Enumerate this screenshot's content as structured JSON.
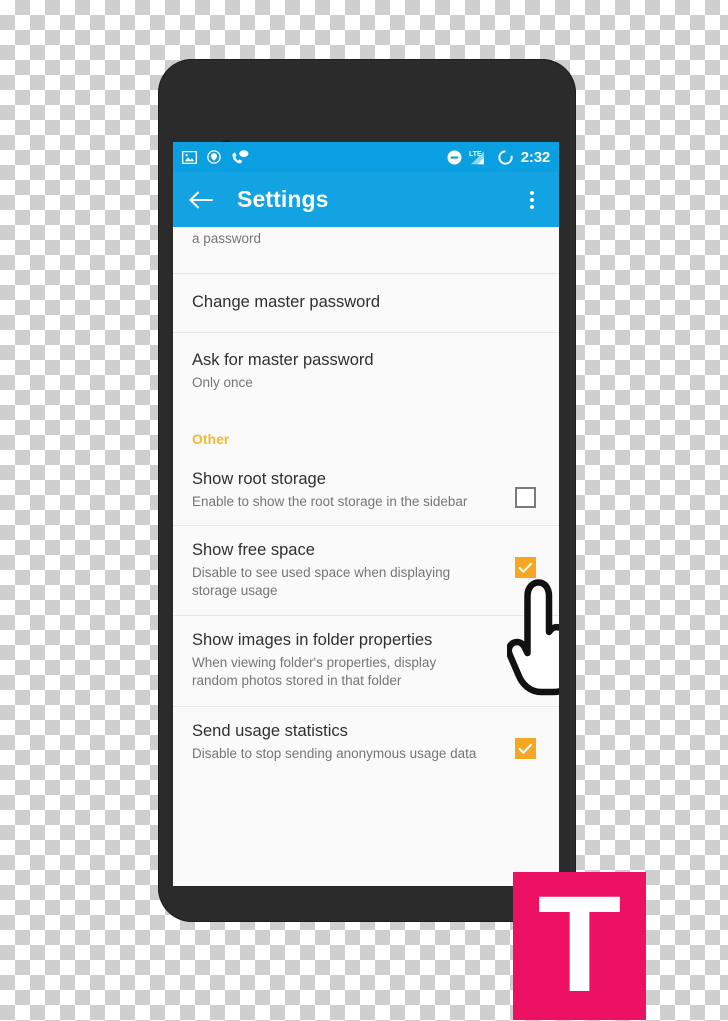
{
  "statusbar": {
    "left_icons": [
      "image-icon",
      "shield-location-icon",
      "phone-missed-call-icon"
    ],
    "right_icons": [
      "do-not-disturb-icon",
      "lte-signal-icon",
      "battery-circle-icon"
    ],
    "lte_label": "LTE",
    "clock": "2:32"
  },
  "appbar": {
    "back_icon": "arrow-back-icon",
    "title": "Settings",
    "overflow_icon": "overflow-menu-icon"
  },
  "list": {
    "partial_row": {
      "subtitle": "a password"
    },
    "rows": [
      {
        "name": "change-master-password",
        "title": "Change master password",
        "subtitle": "",
        "checkbox": null
      },
      {
        "name": "ask-for-master-password",
        "title": "Ask for master password",
        "subtitle": "Only once",
        "checkbox": null
      }
    ],
    "section_other": {
      "label": "Other",
      "rows": [
        {
          "name": "show-root-storage",
          "title": "Show root storage",
          "subtitle": "Enable to show the root storage in the sidebar",
          "checkbox": "unchecked"
        },
        {
          "name": "show-free-space",
          "title": "Show free space",
          "subtitle": "Disable to see used space when displaying storage usage",
          "checkbox": "checked"
        },
        {
          "name": "show-images-in-folder-properties",
          "title": "Show images in folder properties",
          "subtitle": "When viewing folder's properties, display random photos stored in that folder",
          "checkbox": "checked"
        },
        {
          "name": "send-usage-statistics",
          "title": "Send usage statistics",
          "subtitle": "Disable to stop sending anonymous usage data",
          "checkbox": "checked"
        }
      ]
    }
  },
  "overlay": {
    "hand_cursor_icon": "pointing-hand-cursor-icon"
  },
  "watermark": {
    "letter": "T",
    "background_color": "#ec1163",
    "letter_color": "#ffffff"
  },
  "colors": {
    "status_bar": "#0a9fe0",
    "app_bar": "#14a3e2",
    "accent_checkbox": "#f5a623",
    "section_header": "#f3ba34",
    "phone_body": "#2b2b2b",
    "screen_background": "#fafafa"
  }
}
